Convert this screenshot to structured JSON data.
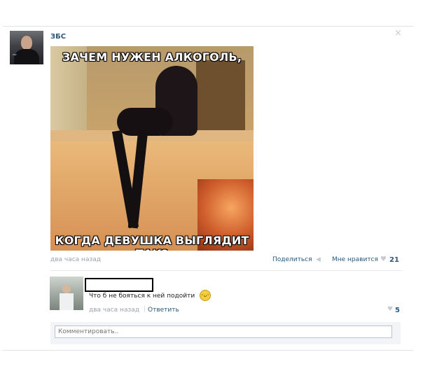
{
  "post": {
    "author": "ЗБС",
    "close_symbol": "×",
    "meme_caption_top": "ЗАЧЕМ НУЖЕН АЛКОГОЛЬ,",
    "meme_caption_bottom": "КОГДА ДЕВУШКА ВЫГЛЯДИТ ТАК?",
    "time": "два часа назад",
    "device_symbol": "",
    "share_label": "Поделиться",
    "share_icon": "megaphone-icon",
    "like_label": "Мне нравится",
    "like_symbol": "♥",
    "like_count": "21"
  },
  "comment": {
    "text": "Что б не бояться к ней подойти",
    "emoji": "😆",
    "time": "два часа назад",
    "separator": "|",
    "reply_label": "Ответить",
    "like_symbol": "♥",
    "like_count": "5"
  },
  "comment_input": {
    "placeholder": "Комментировать.."
  },
  "colors": {
    "link": "#2b587a",
    "meta": "#9aa4ad",
    "divider": "#e4e8ed"
  }
}
